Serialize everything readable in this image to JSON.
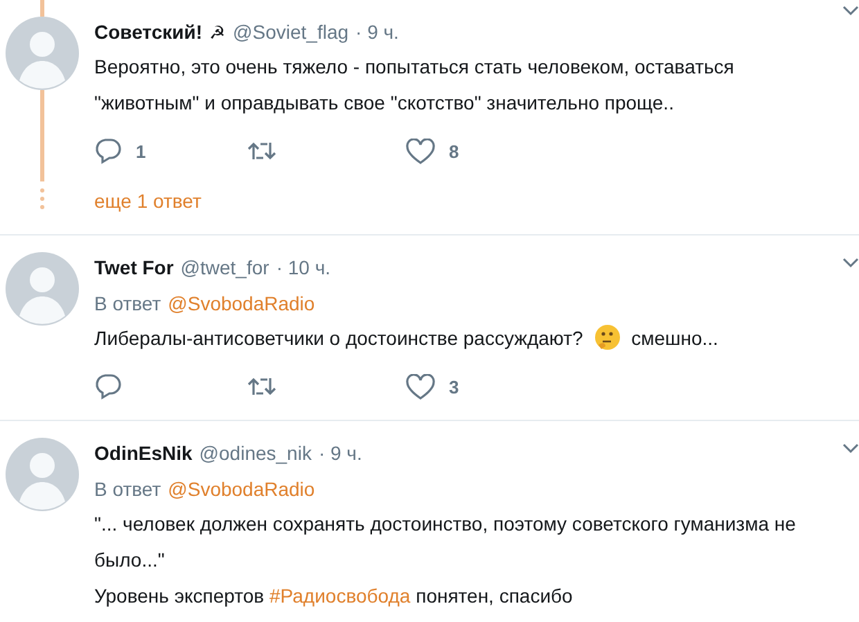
{
  "tweets": [
    {
      "name": "Советский!",
      "name_icon": "☭",
      "handle": "@Soviet_flag",
      "time": "· 9 ч.",
      "threaded": true,
      "body": [
        [
          {
            "kind": "text",
            "text": "Вероятно, это очень тяжело - попытаться стать человеком, оставаться \"животным\" и оправдывать свое \"скотство\" значительно проще.."
          }
        ]
      ],
      "actions": {
        "replies": "1",
        "likes": "8"
      },
      "more_replies": "еще 1 ответ"
    },
    {
      "name": "Twet For",
      "handle": "@twet_for",
      "time": "· 10 ч.",
      "threaded": false,
      "reply_to": {
        "label": "В ответ",
        "user": "@SvobodaRadio"
      },
      "body": [
        [
          {
            "kind": "text",
            "text": "Либералы-антисоветчики о достоинстве рассуждают?"
          },
          {
            "kind": "emoji"
          },
          {
            "kind": "text",
            "text": "смешно..."
          }
        ]
      ],
      "actions": {
        "likes": "3"
      }
    },
    {
      "name": "OdinEsNik",
      "handle": "@odines_nik",
      "time": "· 9 ч.",
      "threaded": false,
      "reply_to": {
        "label": "В ответ",
        "user": "@SvobodaRadio"
      },
      "body": [
        [
          {
            "kind": "text",
            "text": "\"... человек должен сохранять достоинство, поэтому советского гуманизма не было...\""
          }
        ],
        [
          {
            "kind": "text",
            "text": "Уровень экспертов"
          },
          {
            "kind": "hashtag",
            "text": "#Радиосвобода"
          },
          {
            "kind": "text",
            "text": "понятен, спасибо"
          }
        ]
      ]
    }
  ]
}
